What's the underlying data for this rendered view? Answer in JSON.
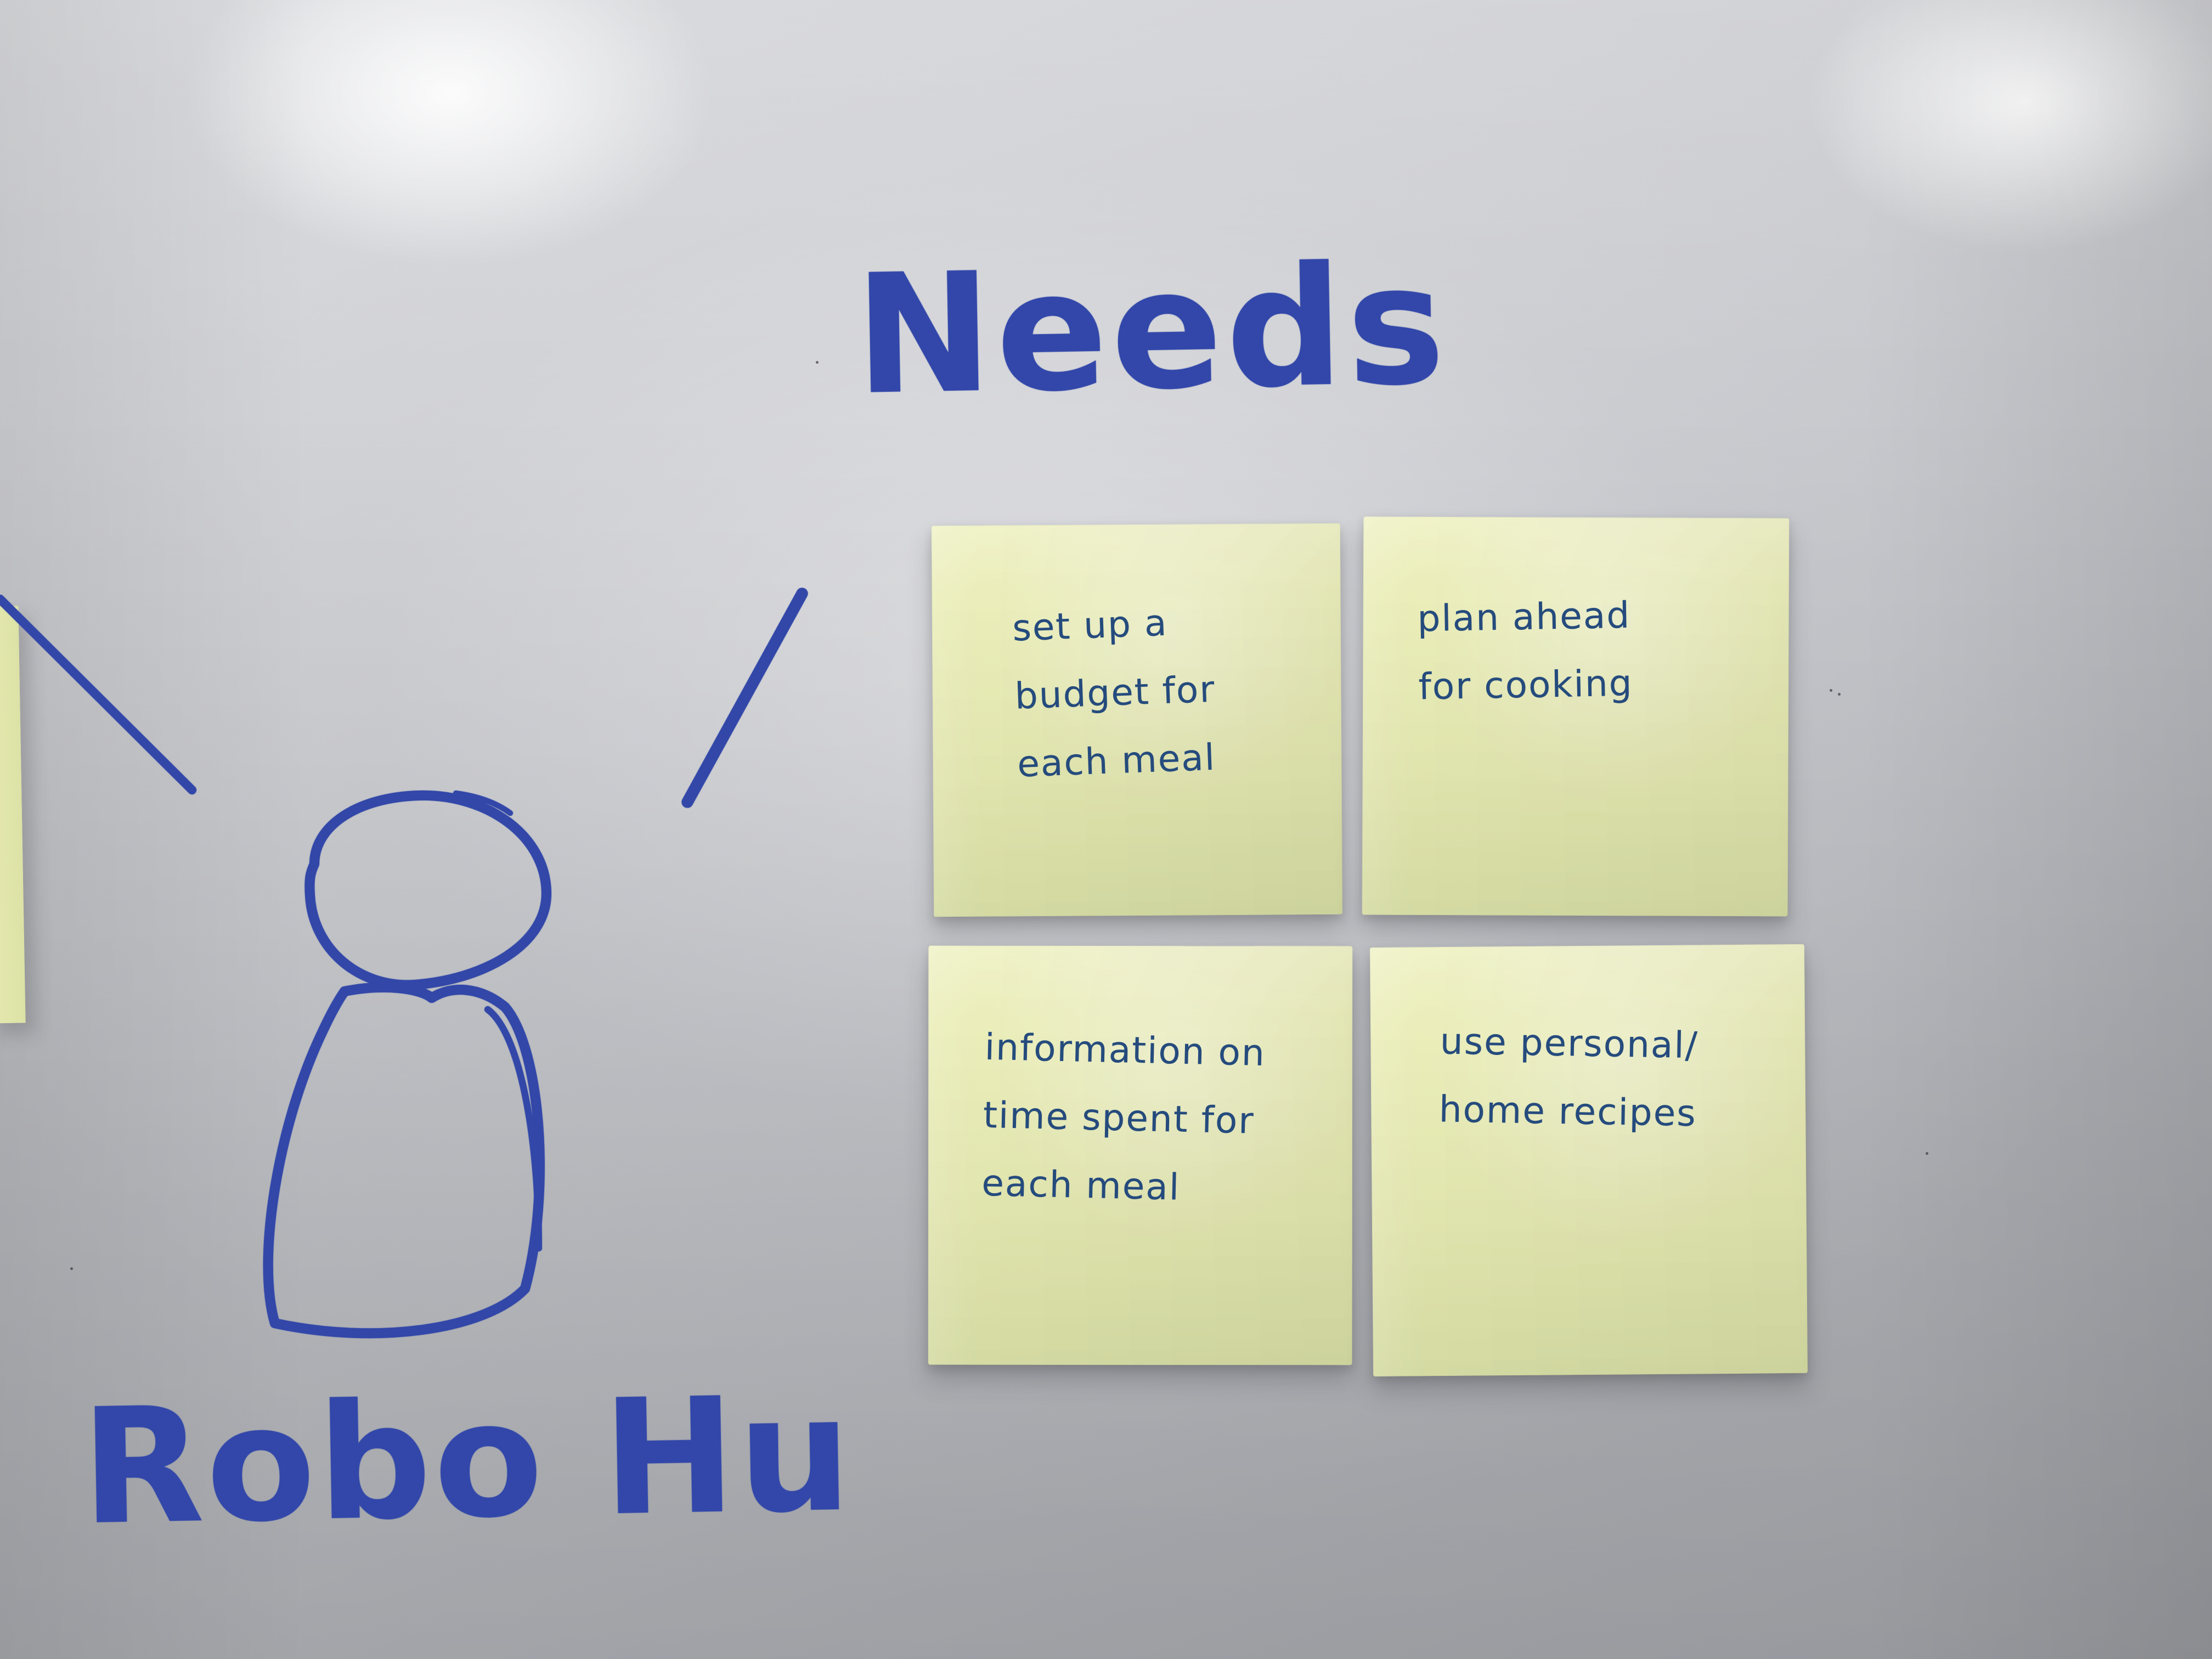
{
  "scene": {
    "title": "Needs",
    "persona_name": "Robo Hu",
    "board_color": "#cfd0d4",
    "marker_color": "#3147a8",
    "note_color": "#e8ecb4",
    "handwriting_color": "#254b7d"
  },
  "sticky_notes": [
    {
      "text": "set up a\nbudget for\neach meal"
    },
    {
      "text": "plan ahead\nfor cooking"
    },
    {
      "text": "information on\ntime spent for\neach meal"
    },
    {
      "text": "use personal/\nhome recipes"
    }
  ]
}
